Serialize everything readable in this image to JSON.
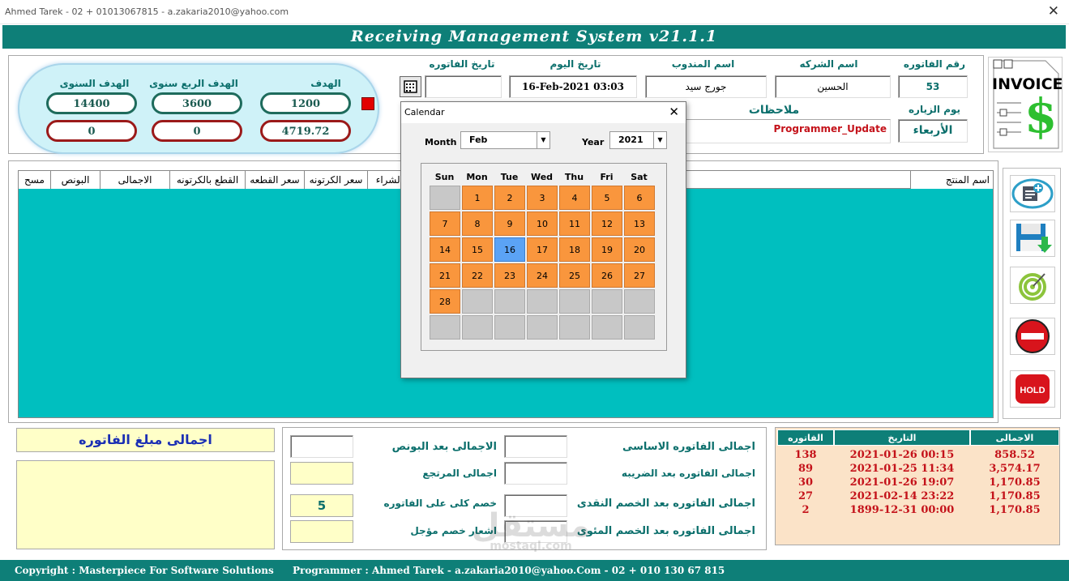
{
  "window": {
    "title": "Ahmed Tarek - 02 + 01013067815 - a.zakaria2010@yahoo.com",
    "app_title": "Receiving Management System v21.1.1"
  },
  "targets": {
    "annual_label": "الهدف السنوى",
    "quarterly_label": "الهدف الربع سنوى",
    "target_label": "الهدف",
    "annual_value": "14400",
    "quarterly_value": "3600",
    "target_value": "1200",
    "annual_actual": "0",
    "quarterly_actual": "0",
    "target_actual": "4719.72"
  },
  "header": {
    "invoice_date_label": "تاريخ الفاتوره",
    "today_label": "تاريخ اليوم",
    "today_value": "16-Feb-2021 03:03",
    "rep_label": "اسم المندوب",
    "rep_value": "جورج سيد",
    "company_label": "اسم الشركه",
    "company_value": "الحسين",
    "invoice_no_label": "رقم الفاتوره",
    "invoice_no_value": "53",
    "notes_label": "ملاحظات",
    "notes_value": "Programmer_Update",
    "visit_day_label": "يوم الزياره",
    "visit_day_value": "الأربعاء",
    "logo_text": "INVOICE",
    "logo_symbol": "$"
  },
  "grid": {
    "columns": [
      "مسح",
      "البونص",
      "الاجمالى",
      "القطع بالكرتونه",
      "سعر القطعه",
      "سعر الكرتونه",
      "سعر الشراء",
      "اسم المنتج"
    ]
  },
  "calendar": {
    "title": "Calendar",
    "month_label": "Month",
    "month_value": "Feb",
    "year_label": "Year",
    "year_value": "2021",
    "weekdays": [
      "Sun",
      "Mon",
      "Tue",
      "Wed",
      "Thu",
      "Fri",
      "Sat"
    ],
    "leading_blanks": 1,
    "days_in_month": 28,
    "selected_day": 16,
    "close_glyph": "✕",
    "arrow_glyph": "▼"
  },
  "summary": {
    "invoice_total_label": "اجمالى مبلغ الفاتوره",
    "basic_total_label": "اجمالى الفاتوره الاساسى",
    "after_tax_label": "اجمالى الفاتوره بعد الضريبه",
    "after_cash_discount_label": "اجمالى الفاتوره بعد الخصم النقدى",
    "after_percent_discount_label": "اجمالى الفاتوره بعد الخصم المئوى",
    "after_bonus_label": "الاجمالى بعد البونص",
    "returns_total_label": "اجمالى المرتجع",
    "total_discount_label": "خصم كلى على الفاتوره",
    "total_discount_value": "5",
    "deferred_discount_label": "اشعار خصم مؤجل"
  },
  "history": {
    "headers": [
      "الفاتوره",
      "التاريخ",
      "الاجمالى"
    ],
    "rows": [
      {
        "invoice": "138",
        "date": "2021-01-26 00:15",
        "total": "858.52"
      },
      {
        "invoice": "89",
        "date": "2021-01-25 11:34",
        "total": "3,574.17"
      },
      {
        "invoice": "30",
        "date": "2021-01-26 19:07",
        "total": "1,170.85"
      },
      {
        "invoice": "27",
        "date": "2021-02-14 23:22",
        "total": "1,170.85"
      },
      {
        "invoice": "2",
        "date": "1899-12-31 00:00",
        "total": "1,170.85"
      }
    ]
  },
  "footer": {
    "copyright": "Copyright : Masterpiece For Software Solutions",
    "programmer": "Programmer : Ahmed Tarek  -  a.zakaria2010@yahoo.Com  -  02 + 010 130 67 815"
  },
  "watermark": {
    "text": "مستقل",
    "sub": "mostaql.com"
  },
  "colors": {
    "teal": "#0e7f78",
    "grid": "#00bfbf",
    "orange_day": "#f9963d",
    "selected_day": "#5ba3f5",
    "red": "#c4121a"
  }
}
